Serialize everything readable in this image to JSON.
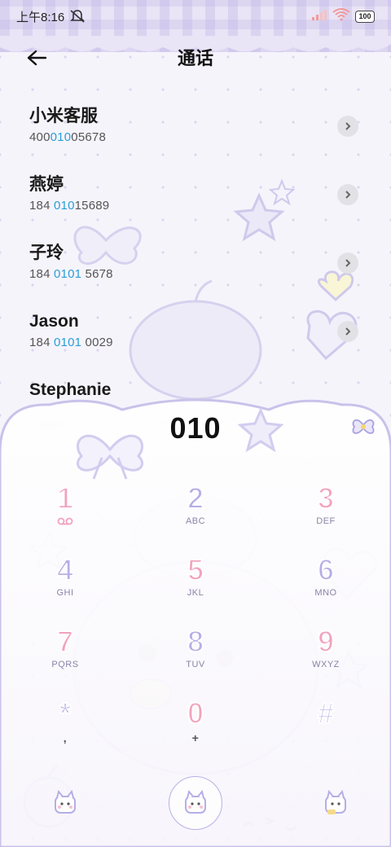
{
  "status_bar": {
    "time": "上午8:16",
    "battery": "100"
  },
  "header": {
    "title": "通话"
  },
  "contacts": [
    {
      "name": "小米客服",
      "number_parts": [
        "400",
        "010",
        "05678"
      ]
    },
    {
      "name": "燕婷",
      "number_parts": [
        "184 ",
        "010",
        "15689"
      ]
    },
    {
      "name": "子玲",
      "number_parts": [
        "184 ",
        "0101",
        " 5678"
      ]
    },
    {
      "name": "Jason",
      "number_parts": [
        "184 ",
        "0101",
        " 0029"
      ]
    },
    {
      "name": "Stephanie",
      "number_parts": [
        "",
        "",
        ""
      ]
    }
  ],
  "dialer": {
    "display_number": "010",
    "keys": [
      {
        "digit": "1",
        "letters": "",
        "sub_icon": "voicemail-icon",
        "color": "pink"
      },
      {
        "digit": "2",
        "letters": "ABC",
        "color": "purple"
      },
      {
        "digit": "3",
        "letters": "DEF",
        "color": "pink"
      },
      {
        "digit": "4",
        "letters": "GHI",
        "color": "purple"
      },
      {
        "digit": "5",
        "letters": "JKL",
        "color": "pink"
      },
      {
        "digit": "6",
        "letters": "MNO",
        "color": "purple"
      },
      {
        "digit": "7",
        "letters": "PQRS",
        "color": "pink"
      },
      {
        "digit": "8",
        "letters": "TUV",
        "color": "purple"
      },
      {
        "digit": "9",
        "letters": "WXYZ",
        "color": "pink"
      },
      {
        "digit": "*",
        "letters": ",",
        "color": "purple"
      },
      {
        "digit": "0",
        "letters": "+",
        "color": "pink"
      },
      {
        "digit": "#",
        "letters": "",
        "color": "purple"
      }
    ]
  },
  "colors": {
    "accent_pink": "#f2a3bd",
    "accent_purple": "#b5aee6",
    "highlight_blue": "#2a9fd6"
  }
}
